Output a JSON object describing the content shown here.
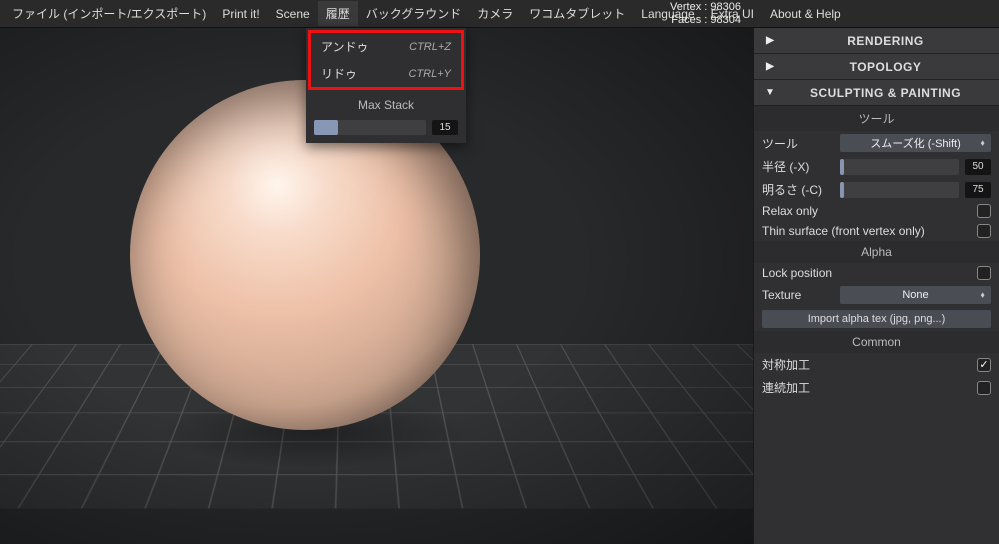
{
  "menubar": {
    "items": [
      "ファイル (インポート/エクスポート)",
      "Print it!",
      "Scene",
      "履歴",
      "バックグラウンド",
      "カメラ",
      "ワコムタブレット",
      "Language",
      "Extra UI",
      "About & Help"
    ],
    "active_index": 3
  },
  "stats": {
    "vertex_label": "Vertex : 98306",
    "faces_label": "Faces : 98304"
  },
  "history_menu": {
    "undo_label": "アンドゥ",
    "undo_shortcut": "CTRL+Z",
    "redo_label": "リドゥ",
    "redo_shortcut": "CTRL+Y",
    "max_stack_label": "Max Stack",
    "max_stack_value": "15"
  },
  "right_panel": {
    "sections": [
      {
        "title": "RENDERING",
        "expanded": false
      },
      {
        "title": "TOPOLOGY",
        "expanded": false
      },
      {
        "title": "SCULPTING & PAINTING",
        "expanded": true
      }
    ],
    "sculpt": {
      "tool_group_label": "ツール",
      "tool_label": "ツール",
      "tool_value": "スムーズ化 (-Shift)",
      "radius_label": "半径 (-X)",
      "radius_value": "50",
      "radius_fill_pct": 3,
      "intensity_label": "明るさ (-C)",
      "intensity_value": "75",
      "intensity_fill_pct": 3,
      "relax_label": "Relax only",
      "relax_checked": false,
      "thin_label": "Thin surface (front vertex only)",
      "thin_checked": false,
      "alpha_group_label": "Alpha",
      "lock_label": "Lock position",
      "lock_checked": false,
      "texture_label": "Texture",
      "texture_value": "None",
      "import_alpha_btn": "Import alpha tex (jpg, png...)",
      "common_group_label": "Common",
      "symmetry_label": "対称加工",
      "symmetry_checked": true,
      "continuous_label": "連続加工",
      "continuous_checked": false
    }
  }
}
